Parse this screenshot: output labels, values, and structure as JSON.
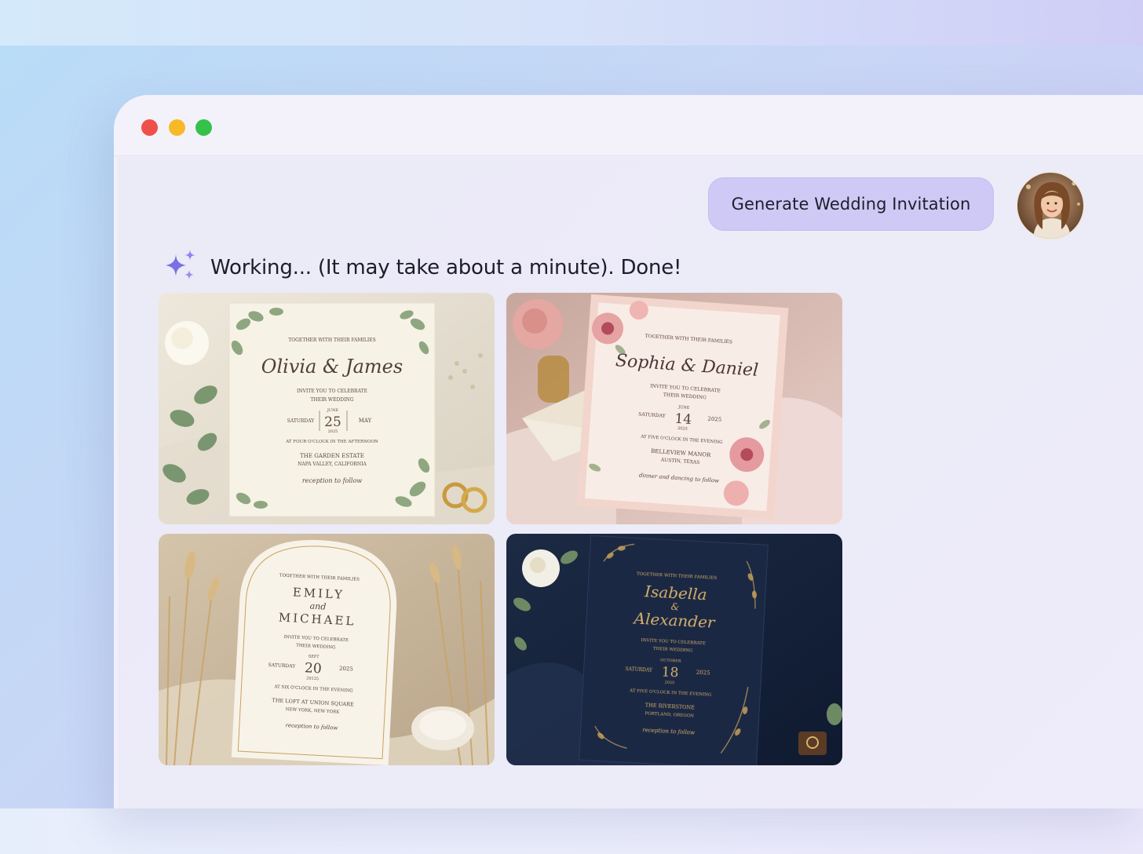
{
  "window": {
    "controls": [
      "close",
      "minimize",
      "maximize"
    ]
  },
  "chat": {
    "user_prompt": "Generate Wedding Invitation",
    "status_message": "Working... (It may take about a minute). Done!",
    "status_icon": "sparkles-icon"
  },
  "colors": {
    "accent": "#cfc9f5",
    "sparkle": "#7b6fe4"
  },
  "invitations": [
    {
      "header": "TOGETHER WITH THEIR FAMILIES",
      "names": "Olivia & James",
      "invite": "INVITE YOU TO CELEBRATE",
      "invite2": "THEIR WEDDING",
      "weekday": "SATURDAY",
      "month_top": "JUNE",
      "day": "25",
      "year_small": "2025",
      "right": "MAY",
      "time": "AT FOUR O'CLOCK IN THE AFTERNOON",
      "venue": "THE GARDEN ESTATE",
      "location": "NAPA VALLEY, CALIFORNIA",
      "footer": "reception to follow"
    },
    {
      "header": "TOGETHER WITH THEIR FAMILIES",
      "names": "Sophia & Daniel",
      "invite": "INVITE YOU TO CELEBRATE",
      "invite2": "THEIR WEDDING",
      "weekday": "SATURDAY",
      "month_top": "JUNE",
      "day": "14",
      "year_small": "2025",
      "right": "2025",
      "time": "AT FIVE O'CLOCK IN THE EVENING",
      "venue": "BELLEVIEW MANOR",
      "location": "AUSTIN, TEXAS",
      "footer": "dinner and dancing to follow"
    },
    {
      "header": "TOGETHER WITH THEIR FAMILIES",
      "name1": "EMILY",
      "and": "and",
      "name2": "MICHAEL",
      "invite": "INVITE YOU TO CELEBRATE",
      "invite2": "THEIR WEDDING",
      "weekday": "SATURDAY",
      "month_top": "SEPT",
      "day": "20",
      "year_small": "20125",
      "right": "2025",
      "time": "AT SIX O'CLOCK IN THE EVENING",
      "venue": "THE LOFT AT UNION SQUARE",
      "location": "NEW YORK, NEW YORK",
      "footer": "reception to follow"
    },
    {
      "header": "TOGETHER WITH THEIR FAMILIES",
      "name1": "Isabella",
      "and": "&",
      "name2": "Alexander",
      "invite": "INVITE YOU TO CELEBRATE",
      "invite2": "THEIR WEDDING",
      "weekday": "SATURDAY",
      "month_top": "OCTOBER",
      "day": "18",
      "year_small": "2025",
      "right": "2025",
      "time": "AT FIVE O'CLOCK IN THE EVENING",
      "venue": "THE RIVERSTONE",
      "location": "PORTLAND, OREGON",
      "footer": "reception to follow"
    }
  ]
}
